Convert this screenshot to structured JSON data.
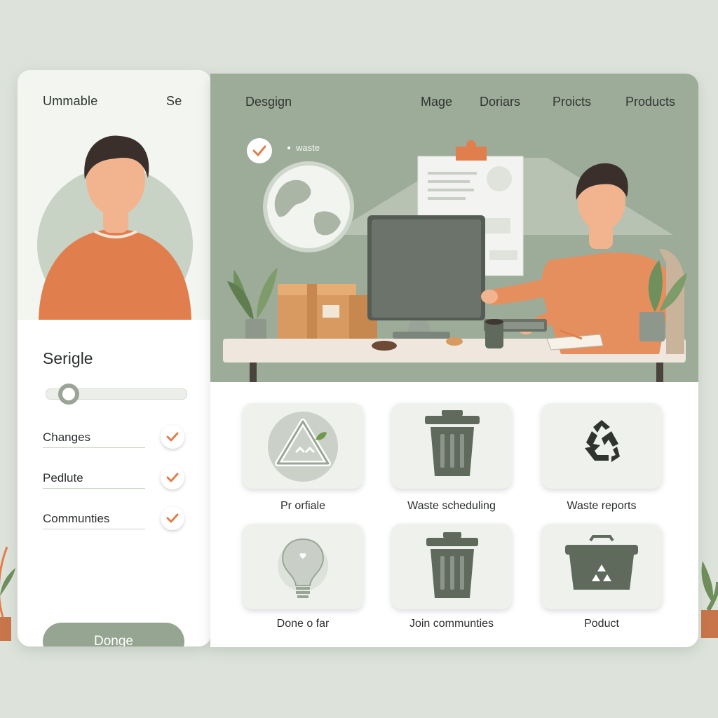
{
  "sidebar": {
    "brand": "Ummable",
    "brand_short": "Se",
    "section_title": "Serigle",
    "slider": {
      "value_fraction": 0.1
    },
    "options": [
      {
        "label": "Changes",
        "checked": true
      },
      {
        "label": "Pedlute",
        "checked": true
      },
      {
        "label": "Communties",
        "checked": true
      }
    ],
    "done_label": "Donge"
  },
  "nav": {
    "logo": "Desgign",
    "items": [
      "Mage",
      "Doriars",
      "Proicts",
      "Products"
    ]
  },
  "hero": {
    "badge_label": "waste"
  },
  "tiles": [
    {
      "label": "Pr orfiale",
      "icon": "recycle-triangle-icon"
    },
    {
      "label": "Waste scheduling",
      "icon": "trash-bin-icon"
    },
    {
      "label": "Waste reports",
      "icon": "recycle-arrows-icon"
    },
    {
      "label": "Done o far",
      "icon": "lightbulb-icon"
    },
    {
      "label": "Join communties",
      "icon": "trash-bin-icon"
    },
    {
      "label": "Poduct",
      "icon": "recycle-bin-icon"
    }
  ],
  "colors": {
    "sage": "#9dab99",
    "accent_orange": "#e07f4d",
    "button_green": "#95a592",
    "icon_dark": "#5f6a5d"
  }
}
